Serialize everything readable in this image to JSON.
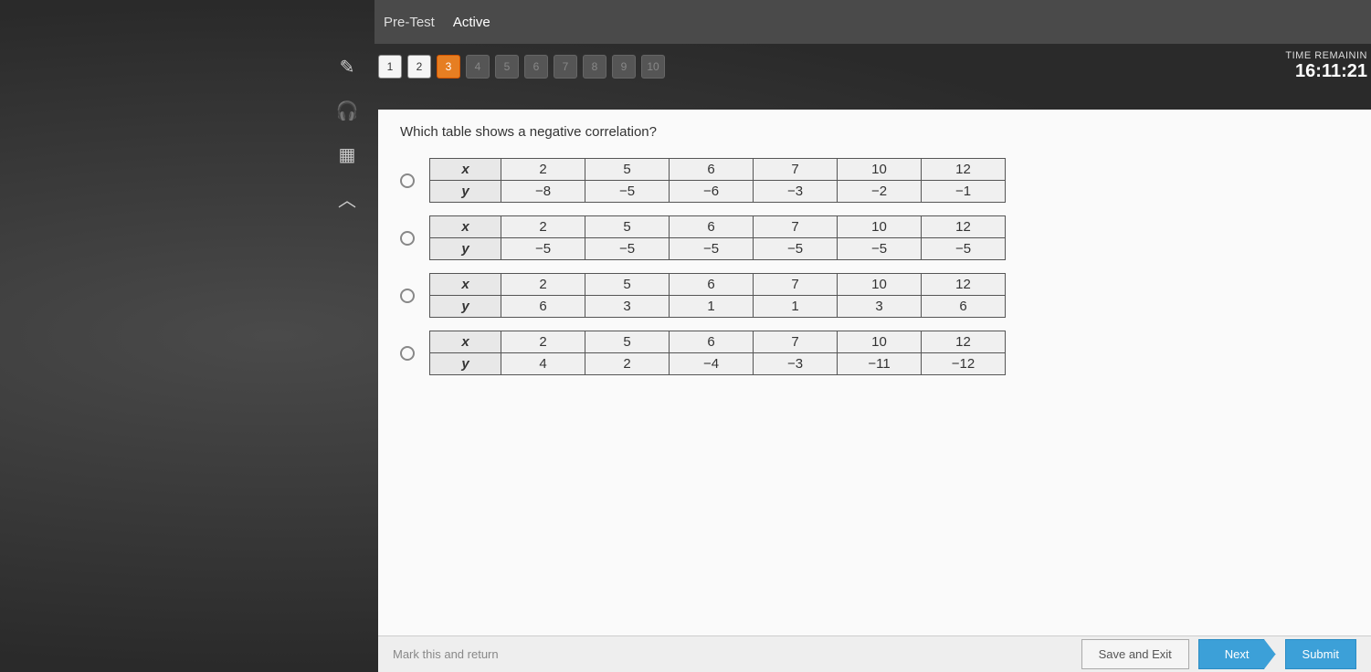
{
  "header": {
    "tab1": "Pre-Test",
    "tab2": "Active"
  },
  "sidebar_tools": {
    "pencil": "✎",
    "headphones": "🎧",
    "calculator": "▦",
    "collapse": "︿"
  },
  "qnav": {
    "items": [
      {
        "n": "1",
        "state": "done"
      },
      {
        "n": "2",
        "state": "done"
      },
      {
        "n": "3",
        "state": "current"
      },
      {
        "n": "4",
        "state": "disabled"
      },
      {
        "n": "5",
        "state": "disabled"
      },
      {
        "n": "6",
        "state": "disabled"
      },
      {
        "n": "7",
        "state": "disabled"
      },
      {
        "n": "8",
        "state": "disabled"
      },
      {
        "n": "9",
        "state": "disabled"
      },
      {
        "n": "10",
        "state": "disabled"
      }
    ]
  },
  "timer": {
    "label": "TIME REMAININ",
    "value": "16:11:21"
  },
  "question": {
    "text": "Which table shows a negative correlation?",
    "options": [
      {
        "rows": [
          {
            "label": "x",
            "vals": [
              "2",
              "5",
              "6",
              "7",
              "10",
              "12"
            ]
          },
          {
            "label": "y",
            "vals": [
              "−8",
              "−5",
              "−6",
              "−3",
              "−2",
              "−1"
            ]
          }
        ]
      },
      {
        "rows": [
          {
            "label": "x",
            "vals": [
              "2",
              "5",
              "6",
              "7",
              "10",
              "12"
            ]
          },
          {
            "label": "y",
            "vals": [
              "−5",
              "−5",
              "−5",
              "−5",
              "−5",
              "−5"
            ]
          }
        ]
      },
      {
        "rows": [
          {
            "label": "x",
            "vals": [
              "2",
              "5",
              "6",
              "7",
              "10",
              "12"
            ]
          },
          {
            "label": "y",
            "vals": [
              "6",
              "3",
              "1",
              "1",
              "3",
              "6"
            ]
          }
        ]
      },
      {
        "rows": [
          {
            "label": "x",
            "vals": [
              "2",
              "5",
              "6",
              "7",
              "10",
              "12"
            ]
          },
          {
            "label": "y",
            "vals": [
              "4",
              "2",
              "−4",
              "−3",
              "−11",
              "−12"
            ]
          }
        ]
      }
    ]
  },
  "footer": {
    "mark": "Mark this and return",
    "save_exit": "Save and Exit",
    "next": "Next",
    "submit": "Submit"
  }
}
